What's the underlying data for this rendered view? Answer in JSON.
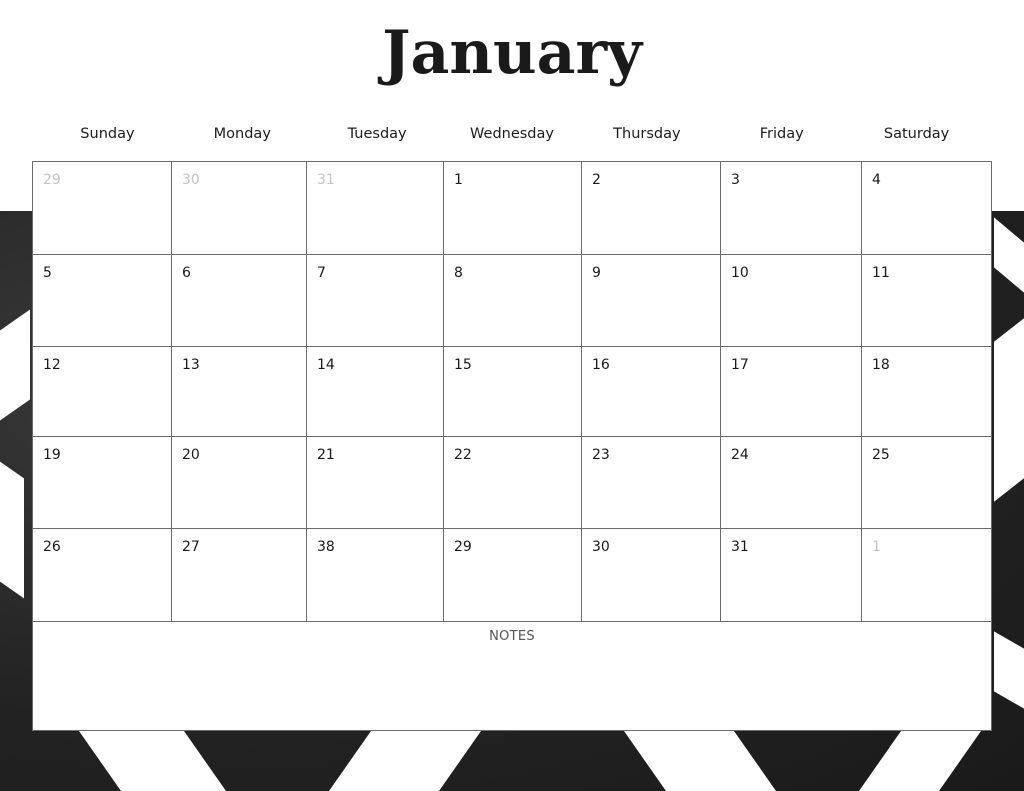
{
  "calendar": {
    "month": "January",
    "weekdays": [
      "Sunday",
      "Monday",
      "Tuesday",
      "Wednesday",
      "Thursday",
      "Friday",
      "Saturday"
    ],
    "weeks": [
      [
        {
          "day": "29",
          "muted": true
        },
        {
          "day": "30",
          "muted": true
        },
        {
          "day": "31",
          "muted": true
        },
        {
          "day": "1",
          "muted": false
        },
        {
          "day": "2",
          "muted": false
        },
        {
          "day": "3",
          "muted": false
        },
        {
          "day": "4",
          "muted": false
        }
      ],
      [
        {
          "day": "5",
          "muted": false
        },
        {
          "day": "6",
          "muted": false
        },
        {
          "day": "7",
          "muted": false
        },
        {
          "day": "8",
          "muted": false
        },
        {
          "day": "9",
          "muted": false
        },
        {
          "day": "10",
          "muted": false
        },
        {
          "day": "11",
          "muted": false
        }
      ],
      [
        {
          "day": "12",
          "muted": false
        },
        {
          "day": "13",
          "muted": false
        },
        {
          "day": "14",
          "muted": false
        },
        {
          "day": "15",
          "muted": false
        },
        {
          "day": "16",
          "muted": false
        },
        {
          "day": "17",
          "muted": false
        },
        {
          "day": "18",
          "muted": false
        }
      ],
      [
        {
          "day": "19",
          "muted": false
        },
        {
          "day": "20",
          "muted": false
        },
        {
          "day": "21",
          "muted": false
        },
        {
          "day": "22",
          "muted": false
        },
        {
          "day": "23",
          "muted": false
        },
        {
          "day": "24",
          "muted": false
        },
        {
          "day": "25",
          "muted": false
        }
      ],
      [
        {
          "day": "26",
          "muted": false
        },
        {
          "day": "27",
          "muted": false
        },
        {
          "day": "38",
          "muted": false
        },
        {
          "day": "29",
          "muted": false
        },
        {
          "day": "30",
          "muted": false
        },
        {
          "day": "31",
          "muted": false
        },
        {
          "day": "1",
          "muted": true
        }
      ]
    ],
    "notes_label": "NOTES"
  },
  "colors": {
    "text": "#1a1a1a",
    "muted_text": "#c4c4c4",
    "grid_line": "#6b6b6b",
    "background_texture": "#222222"
  }
}
